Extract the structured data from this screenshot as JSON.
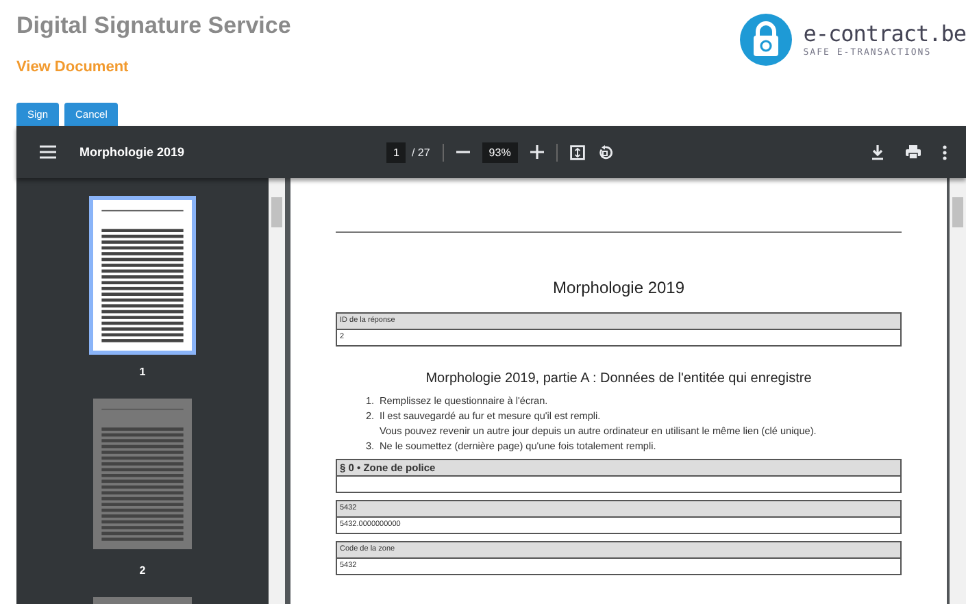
{
  "header": {
    "title": "Digital Signature Service",
    "subtitle": "View Document",
    "logo": {
      "name": "e-contract.be",
      "tagline": "SAFE E-TRANSACTIONS"
    }
  },
  "actions": [
    {
      "label": "Sign"
    },
    {
      "label": "Cancel"
    }
  ],
  "viewer": {
    "title": "Morphologie 2019",
    "page": "1",
    "page_count": "/ 27",
    "zoom": "93%",
    "thumbnails": [
      {
        "label": "1",
        "selected": true
      },
      {
        "label": "2",
        "selected": false
      },
      {
        "selected": false
      }
    ],
    "document": {
      "title": "Morphologie 2019",
      "blocks": [
        {
          "kind": "field",
          "label": "ID de la réponse",
          "value": "2"
        },
        {
          "kind": "heading",
          "text": "Morphologie 2019, partie A : Données de l'entitée qui enregistre"
        },
        {
          "kind": "list",
          "items": [
            {
              "marker": "1.",
              "text": "Remplissez le questionnaire à l'écran."
            },
            {
              "marker": "2.",
              "text": "Il est sauvegardé au fur et mesure qu'il est rempli."
            },
            {
              "text": "Vous pouvez revenir un autre jour depuis un autre ordinateur en utilisant le même lien (clé unique)."
            },
            {
              "marker": "3.",
              "text": "Ne le soumettez (dernière page) qu'une fois totalement rempli."
            }
          ]
        },
        {
          "kind": "section",
          "label": "§ 0 • Zone de police"
        },
        {
          "kind": "field",
          "label": "5432",
          "value": "5432.0000000000"
        },
        {
          "kind": "field",
          "label": "Code de la zone",
          "value": "5432"
        }
      ]
    }
  }
}
